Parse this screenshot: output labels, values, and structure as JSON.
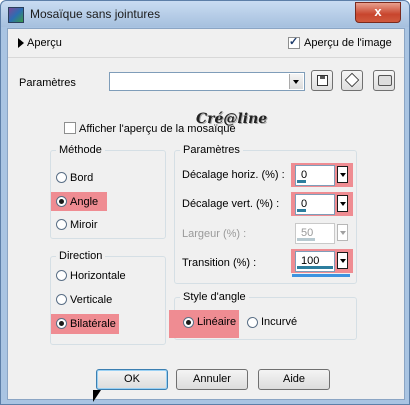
{
  "window": {
    "title": "Mosaïque sans jointures",
    "close_glyph": "x"
  },
  "apercu": {
    "toggle_label": "Aperçu",
    "preview_image_label": "Aperçu de l'image",
    "preview_image_checked": true
  },
  "presets": {
    "label": "Paramètres",
    "value": ""
  },
  "watermark": "Cré@line",
  "mosaic_preview": {
    "label": "Afficher l'aperçu de la mosaïque",
    "checked": false
  },
  "methode": {
    "title": "Méthode",
    "options": [
      "Bord",
      "Angle",
      "Miroir"
    ],
    "selected": "Angle"
  },
  "direction": {
    "title": "Direction",
    "options": [
      "Horizontale",
      "Verticale",
      "Bilatérale"
    ],
    "selected": "Bilatérale"
  },
  "parametres": {
    "title": "Paramètres",
    "fields": [
      {
        "label": "Décalage horiz. (%) :",
        "value": "0",
        "fill": 0.0,
        "enabled": true
      },
      {
        "label": "Décalage vert. (%) :",
        "value": "0",
        "fill": 0.0,
        "enabled": true
      },
      {
        "label": "Largeur (%) :",
        "value": "50",
        "fill": 0.5,
        "enabled": false
      },
      {
        "label": "Transition (%) :",
        "value": "100",
        "fill": 1.0,
        "enabled": true
      }
    ]
  },
  "style_angle": {
    "title": "Style d'angle",
    "options": [
      "Linéaire",
      "Incurvé"
    ],
    "selected": "Linéaire"
  },
  "buttons": {
    "ok": "OK",
    "cancel": "Annuler",
    "help": "Aide"
  },
  "colors": {
    "highlight": "#ef8c92",
    "titlebar": "#a9c4e2",
    "close": "#c8452d"
  }
}
